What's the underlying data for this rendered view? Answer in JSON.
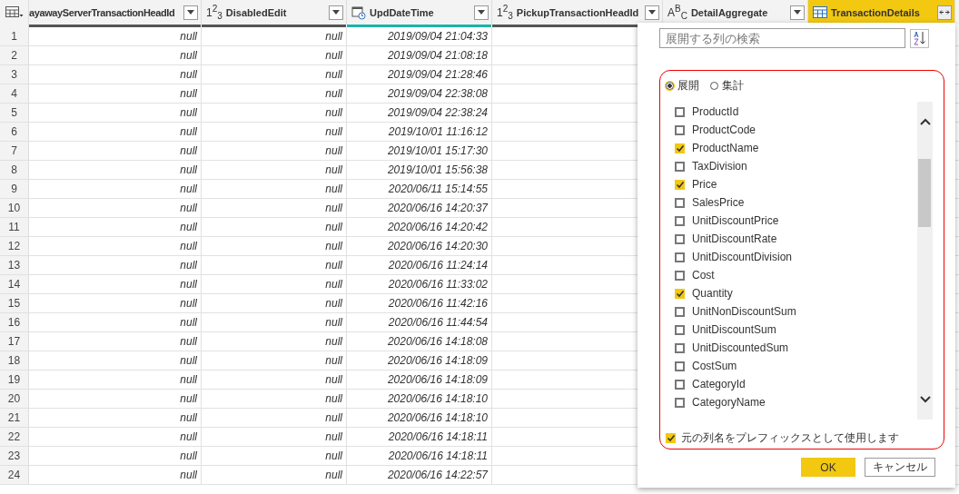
{
  "table": {
    "columns": [
      {
        "name": "ayawayServerTransactionHeadId",
        "kind": "cut",
        "selected": false
      },
      {
        "name": "DisabledEdit",
        "kind": "number",
        "type_glyph": "1$^{2}$$_{3}$",
        "selected": false
      },
      {
        "name": "UpdDateTime",
        "kind": "datetime",
        "selected": false
      },
      {
        "name": "PickupTransactionHeadId",
        "kind": "number",
        "type_glyph": "1$^{2}$$_{3}$",
        "selected": false
      },
      {
        "name": "DetailAggregate",
        "kind": "text",
        "type_glyph": "A$^{B}$$_{C}$",
        "selected": false
      },
      {
        "name": "TransactionDetails",
        "kind": "table",
        "selected": true
      }
    ],
    "rows": [
      {
        "number": "1",
        "cells": [
          "null",
          "null",
          "2019/09/04 21:04:33"
        ]
      },
      {
        "number": "2",
        "cells": [
          "null",
          "null",
          "2019/09/04 21:08:18"
        ]
      },
      {
        "number": "3",
        "cells": [
          "null",
          "null",
          "2019/09/04 21:28:46"
        ]
      },
      {
        "number": "4",
        "cells": [
          "null",
          "null",
          "2019/09/04 22:38:08"
        ]
      },
      {
        "number": "5",
        "cells": [
          "null",
          "null",
          "2019/09/04 22:38:24"
        ]
      },
      {
        "number": "6",
        "cells": [
          "null",
          "null",
          "2019/10/01 11:16:12"
        ]
      },
      {
        "number": "7",
        "cells": [
          "null",
          "null",
          "2019/10/01 15:17:30"
        ]
      },
      {
        "number": "8",
        "cells": [
          "null",
          "null",
          "2019/10/01 15:56:38"
        ]
      },
      {
        "number": "9",
        "cells": [
          "null",
          "null",
          "2020/06/11 15:14:55"
        ]
      },
      {
        "number": "10",
        "cells": [
          "null",
          "null",
          "2020/06/16 14:20:37"
        ]
      },
      {
        "number": "11",
        "cells": [
          "null",
          "null",
          "2020/06/16 14:20:42"
        ]
      },
      {
        "number": "12",
        "cells": [
          "null",
          "null",
          "2020/06/16 14:20:30"
        ]
      },
      {
        "number": "13",
        "cells": [
          "null",
          "null",
          "2020/06/16 11:24:14"
        ]
      },
      {
        "number": "14",
        "cells": [
          "null",
          "null",
          "2020/06/16 11:33:02"
        ]
      },
      {
        "number": "15",
        "cells": [
          "null",
          "null",
          "2020/06/16 11:42:16"
        ]
      },
      {
        "number": "16",
        "cells": [
          "null",
          "null",
          "2020/06/16 11:44:54"
        ]
      },
      {
        "number": "17",
        "cells": [
          "null",
          "null",
          "2020/06/16 14:18:08"
        ]
      },
      {
        "number": "18",
        "cells": [
          "null",
          "null",
          "2020/06/16 14:18:09"
        ]
      },
      {
        "number": "19",
        "cells": [
          "null",
          "null",
          "2020/06/16 14:18:09"
        ]
      },
      {
        "number": "20",
        "cells": [
          "null",
          "null",
          "2020/06/16 14:18:10"
        ]
      },
      {
        "number": "21",
        "cells": [
          "null",
          "null",
          "2020/06/16 14:18:10"
        ]
      },
      {
        "number": "22",
        "cells": [
          "null",
          "null",
          "2020/06/16 14:18:11"
        ]
      },
      {
        "number": "23",
        "cells": [
          "null",
          "null",
          "2020/06/16 14:18:11"
        ]
      },
      {
        "number": "24",
        "cells": [
          "null",
          "null",
          "2020/06/16 14:22:57"
        ]
      }
    ]
  },
  "expand_popup": {
    "search": {
      "placeholder": "展開する列の検索"
    },
    "modes": [
      {
        "label": "展開",
        "selected": true
      },
      {
        "label": "集計",
        "selected": false
      }
    ],
    "columns": [
      {
        "label": "ProductId",
        "checked": false
      },
      {
        "label": "ProductCode",
        "checked": false
      },
      {
        "label": "ProductName",
        "checked": true
      },
      {
        "label": "TaxDivision",
        "checked": false
      },
      {
        "label": "Price",
        "checked": true
      },
      {
        "label": "SalesPrice",
        "checked": false
      },
      {
        "label": "UnitDiscountPrice",
        "checked": false
      },
      {
        "label": "UnitDiscountRate",
        "checked": false
      },
      {
        "label": "UnitDiscountDivision",
        "checked": false
      },
      {
        "label": "Cost",
        "checked": false
      },
      {
        "label": "Quantity",
        "checked": true
      },
      {
        "label": "UnitNonDiscountSum",
        "checked": false
      },
      {
        "label": "UnitDiscountSum",
        "checked": false
      },
      {
        "label": "UnitDiscountedSum",
        "checked": false
      },
      {
        "label": "CostSum",
        "checked": false
      },
      {
        "label": "CategoryId",
        "checked": false
      },
      {
        "label": "CategoryName",
        "checked": false
      }
    ],
    "prefix_option": {
      "label": "元の列名をプレフィックスとして使用します",
      "checked": true
    },
    "buttons": [
      {
        "label": "OK",
        "kind": "primary"
      },
      {
        "label": "キャンセル",
        "kind": "secondary"
      }
    ]
  }
}
